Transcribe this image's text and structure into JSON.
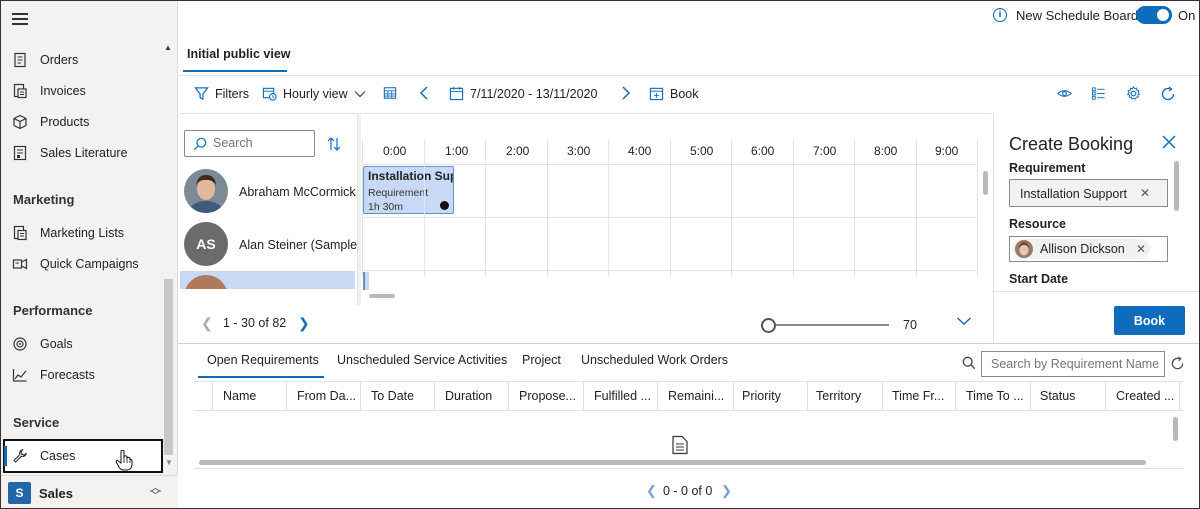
{
  "sidebar": {
    "items_top": [
      {
        "label": "Orders",
        "icon": "orders-icon"
      },
      {
        "label": "Invoices",
        "icon": "invoices-icon"
      },
      {
        "label": "Products",
        "icon": "products-icon"
      },
      {
        "label": "Sales Literature",
        "icon": "sales-literature-icon"
      }
    ],
    "marketing": {
      "heading": "Marketing",
      "items": [
        {
          "label": "Marketing Lists",
          "icon": "marketing-lists-icon"
        },
        {
          "label": "Quick Campaigns",
          "icon": "quick-campaigns-icon"
        }
      ]
    },
    "performance": {
      "heading": "Performance",
      "items": [
        {
          "label": "Goals",
          "icon": "goals-icon"
        },
        {
          "label": "Forecasts",
          "icon": "forecasts-icon"
        }
      ]
    },
    "service": {
      "heading": "Service",
      "items": [
        {
          "label": "Cases",
          "icon": "wrench-icon"
        }
      ]
    },
    "area": {
      "badge": "S",
      "label": "Sales"
    }
  },
  "topbar": {
    "new_board_label": "New Schedule Board",
    "toggle_label": "On",
    "toggle_on": true
  },
  "view_tab": "Initial public view",
  "toolbar": {
    "filters": "Filters",
    "view": "Hourly view",
    "date_range": "7/11/2020 - 13/11/2020",
    "book": "Book"
  },
  "schedule": {
    "search_placeholder": "Search",
    "hours": [
      "0:00",
      "1:00",
      "2:00",
      "3:00",
      "4:00",
      "5:00",
      "6:00",
      "7:00",
      "8:00",
      "9:00"
    ],
    "resources": [
      {
        "name": "Abraham McCormick"
      },
      {
        "name": "Alan Steiner (Sample",
        "initials": "AS"
      }
    ],
    "booking": {
      "title": "Installation Sup",
      "status": "Requirement",
      "duration": "1h 30m"
    },
    "paging": "1 - 30 of 82",
    "zoom": "70"
  },
  "panel": {
    "title": "Create Booking",
    "requirement_label": "Requirement",
    "requirement_value": "Installation Support",
    "resource_label": "Resource",
    "resource_value": "Allison Dickson",
    "start_label": "Start Date",
    "book_button": "Book"
  },
  "requirements": {
    "tabs": [
      "Open Requirements",
      "Unscheduled Service Activities",
      "Project",
      "Unscheduled Work Orders"
    ],
    "search_placeholder": "Search by Requirement Name",
    "columns": [
      "Name",
      "From Da...",
      "To Date",
      "Duration",
      "Propose...",
      "Fulfilled ...",
      "Remaini...",
      "Priority",
      "Territory",
      "Time Fr...",
      "Time To ...",
      "Status",
      "Created ..."
    ],
    "paging": "0 - 0 of 0"
  },
  "colors": {
    "accent": "#0f6cbd",
    "booking": "#c7d9f4",
    "sidebar_bg": "#f3f2f1"
  }
}
